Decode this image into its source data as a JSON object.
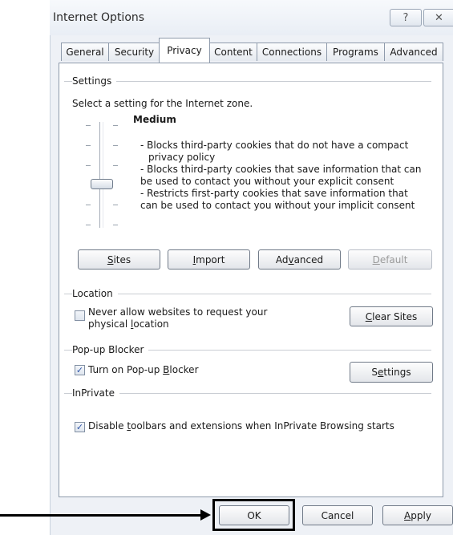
{
  "window": {
    "title": "Internet Options",
    "help_glyph": "?",
    "close_glyph": "✕"
  },
  "tabs": [
    {
      "label": "General"
    },
    {
      "label": "Security"
    },
    {
      "label": "Privacy",
      "active": true
    },
    {
      "label": "Content"
    },
    {
      "label": "Connections"
    },
    {
      "label": "Programs"
    },
    {
      "label": "Advanced"
    }
  ],
  "settings": {
    "group_label": "Settings",
    "prompt": "Select a setting for the Internet zone.",
    "level_title": "Medium",
    "description_lines": [
      "- Blocks third-party cookies that do not have a compact",
      "privacy policy",
      "- Blocks third-party cookies that save information that can",
      "be used to contact you without your explicit consent",
      "- Restricts first-party cookies that save information that",
      "can be used to contact you without your implicit consent"
    ],
    "slider_level": "Medium",
    "buttons": {
      "sites": {
        "pre": "",
        "key": "S",
        "post": "ites"
      },
      "import": {
        "pre": "",
        "key": "I",
        "post": "mport"
      },
      "advanced": {
        "pre": "Ad",
        "key": "v",
        "post": "anced"
      },
      "default": {
        "pre": "",
        "key": "D",
        "post": "efault"
      }
    }
  },
  "location": {
    "group_label": "Location",
    "checkbox_line1": "Never allow websites to request your",
    "checkbox_line2_pre": "physical ",
    "checkbox_line2_key": "l",
    "checkbox_line2_post": "ocation",
    "checked": false,
    "clear_sites": {
      "pre": "",
      "key": "C",
      "post": "lear Sites"
    }
  },
  "popup": {
    "group_label": "Pop-up Blocker",
    "checkbox_pre": "Turn on Pop-up ",
    "checkbox_key": "B",
    "checkbox_post": "locker",
    "checked": true,
    "settings_button": {
      "pre": "S",
      "key": "e",
      "post": "ttings"
    }
  },
  "inprivate": {
    "group_label": "InPrivate",
    "checkbox_pre": "Disable ",
    "checkbox_key": "t",
    "checkbox_post": "oolbars and extensions when InPrivate Browsing starts",
    "checked": true
  },
  "footer": {
    "ok": "OK",
    "cancel": "Cancel",
    "apply_key": "A",
    "apply_post": "pply"
  },
  "check_glyph": "✓"
}
